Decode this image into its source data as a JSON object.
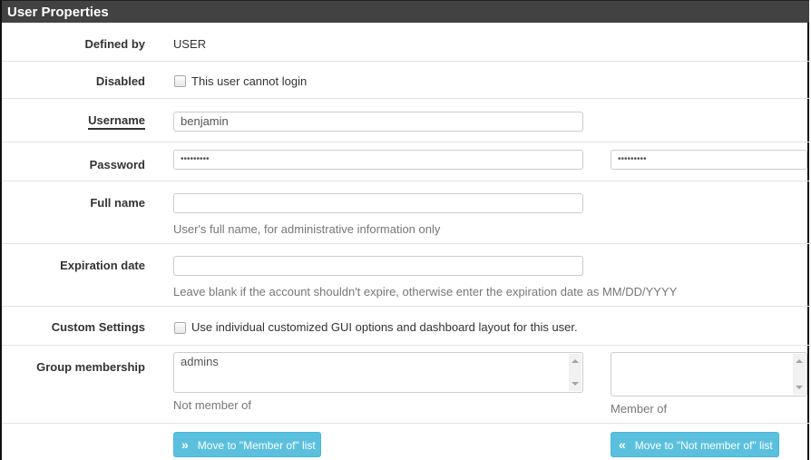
{
  "panel": {
    "title": "User Properties"
  },
  "fields": {
    "defined_by": {
      "label": "Defined by",
      "value": "USER"
    },
    "disabled": {
      "label": "Disabled",
      "checkbox_label": "This user cannot login",
      "checked": false
    },
    "username": {
      "label": "Username",
      "value": "benjamin"
    },
    "password": {
      "label": "Password",
      "value": "•••••••••",
      "confirm_value": "•••••••••"
    },
    "full_name": {
      "label": "Full name",
      "value": "",
      "help": "User's full name, for administrative information only"
    },
    "expiration_date": {
      "label": "Expiration date",
      "value": "",
      "help": "Leave blank if the account shouldn't expire, otherwise enter the expiration date as MM/DD/YYYY"
    },
    "custom_settings": {
      "label": "Custom Settings",
      "checkbox_label": "Use individual customized GUI options and dashboard layout for this user.",
      "checked": false
    },
    "group_membership": {
      "label": "Group membership",
      "not_member_of": {
        "options": [
          "admins"
        ],
        "caption": "Not member of"
      },
      "member_of": {
        "options": [],
        "caption": "Member of"
      }
    }
  },
  "buttons": {
    "move_to_member": {
      "label": "Move to \"Member of\" list",
      "icon": "double-chevron-right"
    },
    "move_to_not_member": {
      "label": "Move to \"Not member of\" list",
      "icon": "double-chevron-left"
    }
  },
  "colors": {
    "header_bg": "#424242",
    "button_info": "#5bc0de"
  }
}
